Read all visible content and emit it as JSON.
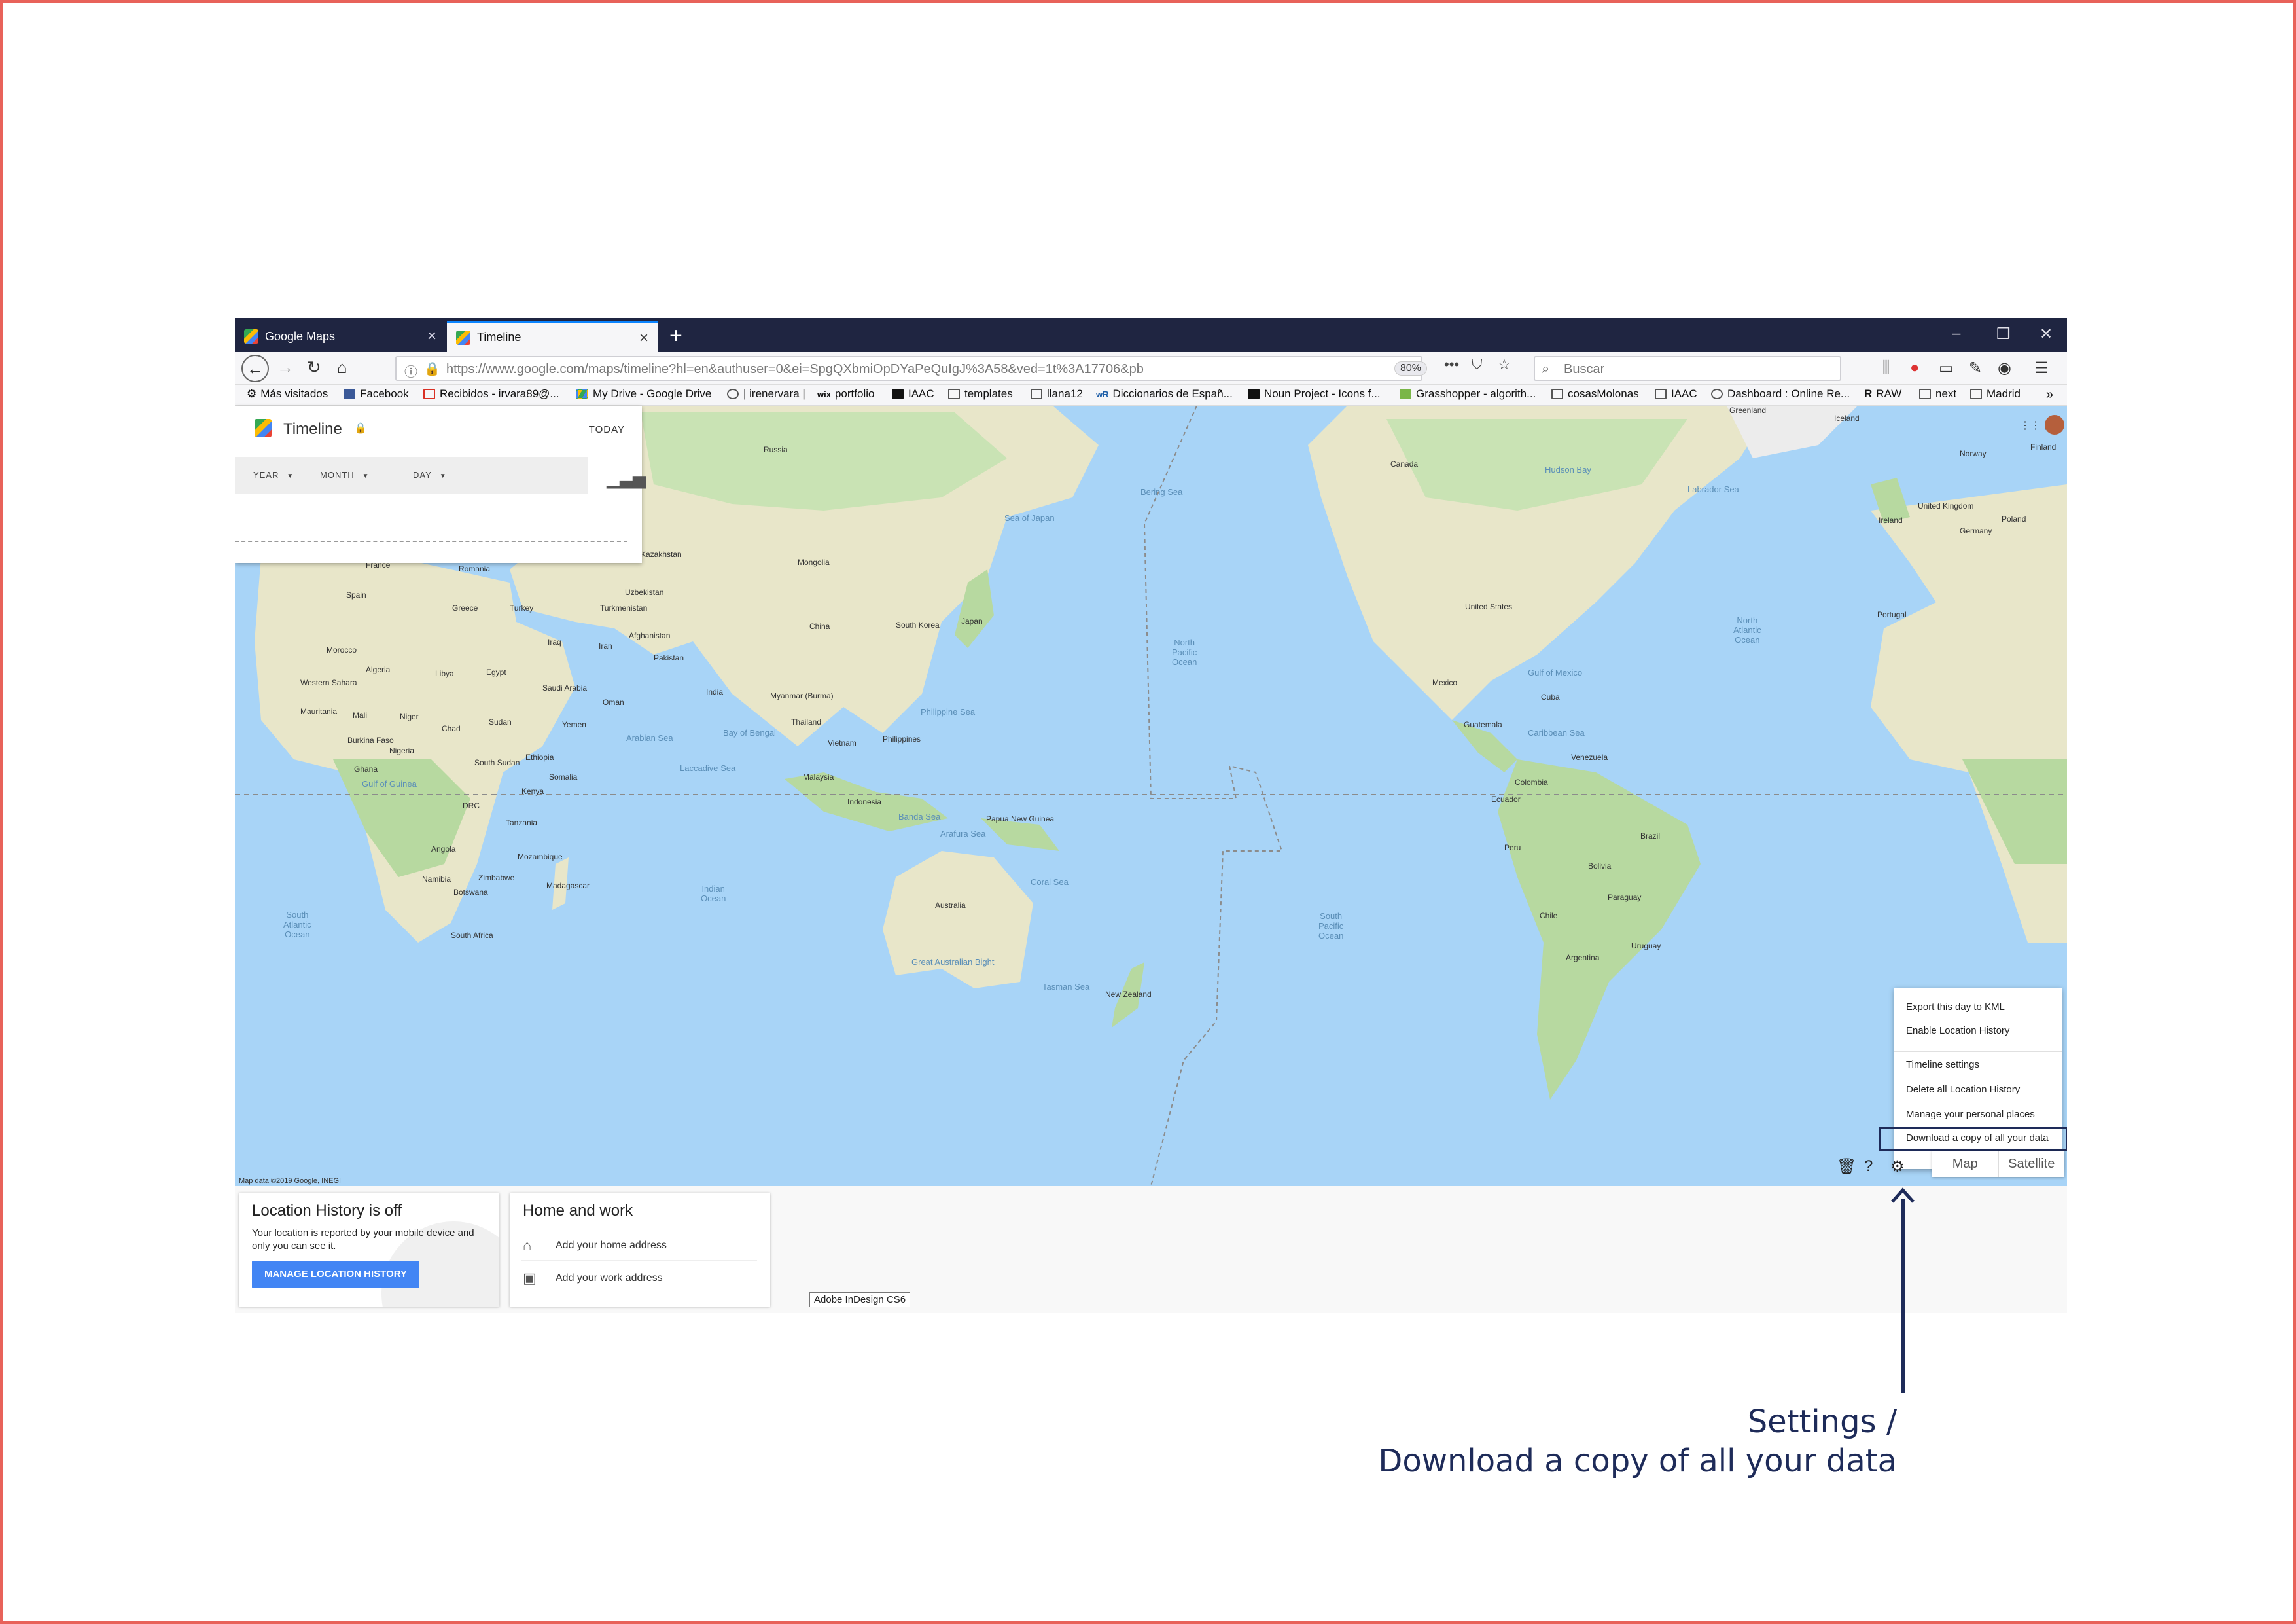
{
  "browser": {
    "tabs": [
      {
        "label": "Google Maps",
        "active": false
      },
      {
        "label": "Timeline",
        "active": true
      }
    ],
    "url": "https://www.google.com/maps/timeline?hl=en&authuser=0&ei=SpgQXbmiOpDYaPeQuIgJ%3A58&ved=1t%3A17706&pb",
    "zoom": "80%",
    "search_placeholder": "Buscar",
    "bookmarks": [
      "Más visitados",
      "Facebook",
      "Recibidos - irvara89@...",
      "My Drive - Google Drive",
      "| irenervara |",
      "portfolio",
      "IAAC",
      "templates",
      "llana12",
      "Diccionarios de Españ...",
      "Noun Project - Icons f...",
      "Grasshopper - algorith...",
      "cosasMolonas",
      "IAAC",
      "Dashboard : Online Re...",
      "RAW",
      "next",
      "Madrid"
    ]
  },
  "timeline": {
    "title": "Timeline",
    "today": "TODAY",
    "selectors": [
      "YEAR",
      "MONTH",
      "DAY"
    ]
  },
  "map": {
    "credit": "Map data ©2019 Google, INEGI",
    "places": [
      "Russia",
      "Mongolia",
      "Kazakhstan",
      "China",
      "India",
      "Pakistan",
      "Afghanistan",
      "Iran",
      "Iraq",
      "Turkey",
      "Saudi Arabia",
      "Egypt",
      "Libya",
      "Algeria",
      "Mali",
      "Niger",
      "Chad",
      "Sudan",
      "Nigeria",
      "Ethiopia",
      "Kenya",
      "Tanzania",
      "DRC",
      "Angola",
      "Namibia",
      "Botswana",
      "South Africa",
      "Madagascar",
      "Mozambique",
      "Zimbabwe",
      "Morocco",
      "Spain",
      "France",
      "Romania",
      "Greece",
      "Japan",
      "South Korea",
      "Thailand",
      "Vietnam",
      "Philippines",
      "Malaysia",
      "Indonesia",
      "Papua New Guinea",
      "Australia",
      "New Zealand",
      "Canada",
      "United States",
      "Mexico",
      "Cuba",
      "Guatemala",
      "Venezuela",
      "Colombia",
      "Peru",
      "Brazil",
      "Bolivia",
      "Chile",
      "Argentina",
      "Paraguay",
      "Uruguay",
      "Ecuador",
      "Greenland",
      "Iceland",
      "Norway",
      "Finland",
      "United Kingdom",
      "Ireland",
      "Germany",
      "Poland",
      "Portugal",
      "Uzbekistan",
      "Turkmenistan",
      "Myanmar (Burma)",
      "Yemen",
      "Somalia",
      "Mauritania",
      "Western Sahara",
      "Ghana",
      "Burkina Faso",
      "South Sudan",
      "Oman"
    ],
    "oceans": [
      "North\nPacific\nOcean",
      "South\nPacific\nOcean",
      "Indian\nOcean",
      "South\nAtlantic\nOcean",
      "North\nAtlantic\nOcean",
      "Bay of Bengal",
      "Arabian Sea",
      "Philippine Sea",
      "Coral Sea",
      "Tasman Sea",
      "Bering Sea",
      "Hudson Bay",
      "Sea of Japan",
      "Gulf of Mexico",
      "Caribbean Sea",
      "Gulf of Guinea",
      "Labrador Sea",
      "Laccadive Sea",
      "Banda Sea",
      "Arafura Sea",
      "Great Australian Bight"
    ]
  },
  "settings_menu": {
    "items": [
      "Export this day to KML",
      "Enable Location History",
      "Timeline settings",
      "Delete all Location History",
      "Manage your personal places",
      "Download a copy of all your data"
    ],
    "highlighted": "Download a copy of all your data"
  },
  "map_type": {
    "map": "Map",
    "satellite": "Satellite"
  },
  "location_history_card": {
    "title": "Location History is off",
    "description": "Your location is reported by your mobile device and only you can see it.",
    "button": "MANAGE LOCATION HISTORY"
  },
  "home_work_card": {
    "title": "Home and work",
    "home": "Add your home address",
    "work": "Add your work address"
  },
  "tooltip": "Adobe InDesign CS6",
  "annotation": {
    "line1": "Settings /",
    "line2": "Download a copy of all your data"
  },
  "colors": {
    "frame": "#e8625a",
    "annotation": "#1e2b59",
    "ocean": "#a8d4f7",
    "land": "#e8e6c9",
    "forest": "#b7d9a0",
    "button": "#4285f4"
  }
}
